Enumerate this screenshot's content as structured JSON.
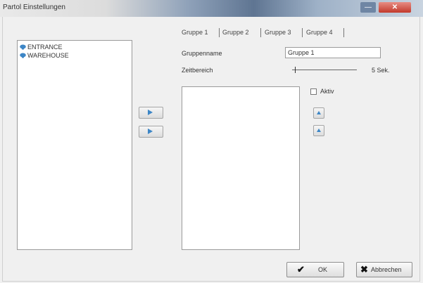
{
  "window": {
    "title": "Partol Einstellungen",
    "close_glyph": "✕",
    "minimize_glyph": "—"
  },
  "camera_list": {
    "items": [
      {
        "label": "ENTRANCE",
        "icon": "camera-icon"
      },
      {
        "label": "WAREHOUSE",
        "icon": "camera-icon"
      }
    ]
  },
  "transfer": {
    "add_icon": "arrow-right-icon",
    "remove_icon": "arrow-right-icon"
  },
  "tabs": [
    {
      "label": "Gruppe 1",
      "active": true
    },
    {
      "label": "Gruppe 2",
      "active": false
    },
    {
      "label": "Gruppe 3",
      "active": false
    },
    {
      "label": "Gruppe 4",
      "active": false
    }
  ],
  "form": {
    "group_name_label": "Gruppenname",
    "group_name_value": "Gruppe 1",
    "time_range_label": "Zeitbereich",
    "time_range_value": "5 Sek.",
    "time_range_level": 0.05,
    "active_label": "Aktiv",
    "active_checked": false
  },
  "order_buttons": {
    "up_icon": "arrow-up-icon",
    "down_icon": "arrow-up-icon"
  },
  "dialog_buttons": {
    "ok_label": "OK",
    "ok_icon": "checkmark-icon",
    "ok_glyph": "✔",
    "cancel_label": "Abbrechen",
    "cancel_icon": "x-icon",
    "cancel_glyph": "✖"
  },
  "colors": {
    "icon_blue": "#3d86c6",
    "close_red": "#c2392b",
    "titlebar_blue": "#5f7592"
  }
}
